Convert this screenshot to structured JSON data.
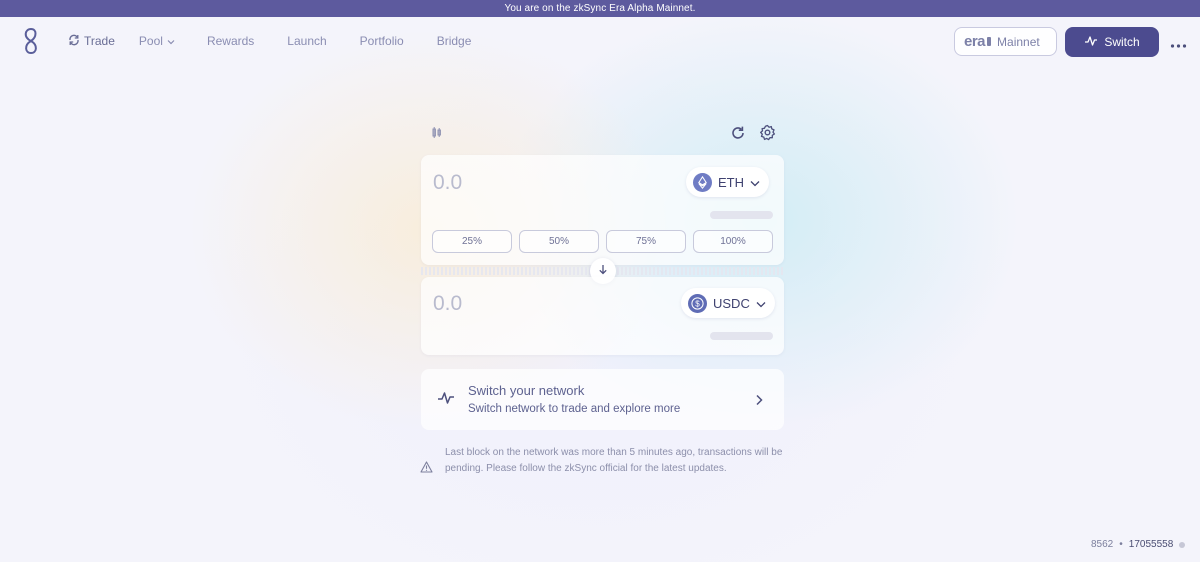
{
  "banner": {
    "text": "You are on the zkSync Era Alpha Mainnet."
  },
  "nav": {
    "items": [
      {
        "label": "Trade",
        "icon": "trade-swap-icon"
      },
      {
        "label": "Pool",
        "icon": "chevron-down-icon"
      },
      {
        "label": "Rewards"
      },
      {
        "label": "Launch"
      },
      {
        "label": "Portfolio"
      },
      {
        "label": "Bridge"
      }
    ]
  },
  "network": {
    "brand": "era",
    "label": "Mainnet"
  },
  "header": {
    "switch_label": "Switch"
  },
  "swap": {
    "from": {
      "amount": "0.0",
      "token": "ETH"
    },
    "to": {
      "amount": "0.0",
      "token": "USDC"
    },
    "percent_buttons": [
      "25%",
      "50%",
      "75%",
      "100%"
    ]
  },
  "switch_network": {
    "title": "Switch your network",
    "subtitle": "Switch network to trade and explore more"
  },
  "warning": {
    "text": "Last block on the network was more than 5 minutes ago, transactions will be pending. Please follow the zkSync official for the latest updates."
  },
  "footer": {
    "latency": "8562",
    "separator": "•",
    "block": "17055558"
  },
  "colors": {
    "banner": "#5d5a9e",
    "primary_button": "#4c4b8f",
    "text": "#4b4f7a",
    "token_icon": "#6f7cc4"
  }
}
